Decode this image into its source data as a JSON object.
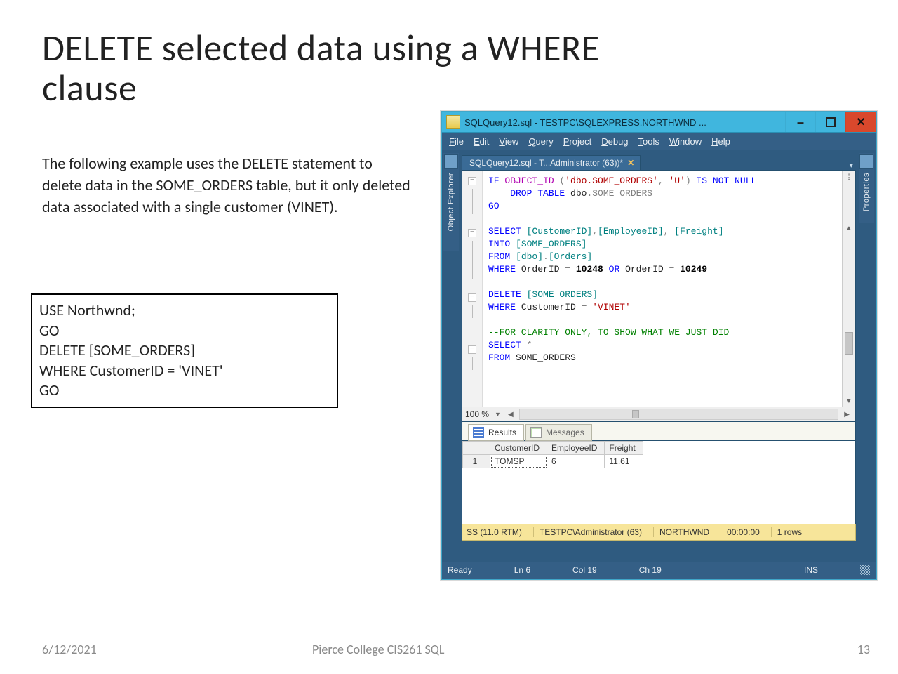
{
  "title": "DELETE selected data using a WHERE clause",
  "body": "The following example uses the DELETE statement to delete data in the SOME_ORDERS table, but it only deleted data associated with a single customer (VINET).",
  "codebox": "USE Northwnd;\nGO\nDELETE [SOME_ORDERS]\nWHERE CustomerID = 'VINET'\nGO",
  "footer": {
    "date": "6/12/2021",
    "center": "Pierce College CIS261 SQL",
    "page": "13"
  },
  "ssms": {
    "window_title": "SQLQuery12.sql - TESTPC\\SQLEXPRESS.NORTHWND ...",
    "menu": [
      "File",
      "Edit",
      "View",
      "Query",
      "Project",
      "Debug",
      "Tools",
      "Window",
      "Help"
    ],
    "tab": "SQLQuery12.sql - T...Administrator (63))*",
    "left_dock": "Object Explorer",
    "right_dock": "Properties",
    "zoom": "100 %",
    "result_tabs": {
      "results": "Results",
      "messages": "Messages"
    },
    "grid": {
      "headers": [
        "CustomerID",
        "EmployeeID",
        "Freight"
      ],
      "rownum": "1",
      "row": [
        "TOMSP",
        "6",
        "11.61"
      ]
    },
    "yellow": {
      "ver": "SS (11.0 RTM)",
      "user": "TESTPC\\Administrator (63)",
      "db": "NORTHWND",
      "time": "00:00:00",
      "rows": "1 rows"
    },
    "status": {
      "ready": "Ready",
      "ln": "Ln 6",
      "col": "Col 19",
      "ch": "Ch 19",
      "ins": "INS"
    },
    "sql": {
      "l1a": "IF",
      "l1b": " OBJECT_ID ",
      "l1c": "(",
      "l1d": "'dbo.SOME_ORDERS'",
      "l1e": ", ",
      "l1f": "'U'",
      "l1g": ")",
      "l1h": " IS NOT NULL",
      "l2a": "    DROP TABLE",
      "l2b": " dbo",
      "l2c": ".SOME_ORDERS",
      "l3": "GO",
      "l5a": "SELECT",
      "l5b": " [CustomerID]",
      "l5c": ",",
      "l5d": "[EmployeeID]",
      "l5e": ", ",
      "l5f": "[Freight]",
      "l6a": "INTO",
      "l6b": " [SOME_ORDERS]",
      "l7a": "FROM",
      "l7b": " [dbo]",
      "l7c": ".",
      "l7d": "[Orders]",
      "l8a": "WHERE",
      "l8b": " OrderID ",
      "l8c": "=",
      "l8d": " 10248 ",
      "l8e": "OR",
      "l8f": " OrderID ",
      "l8g": "=",
      "l8h": " 10249",
      "l10a": "DELETE",
      "l10b": " [SOME_ORDERS]",
      "l11a": "WHERE",
      "l11b": " CustomerID ",
      "l11c": "=",
      "l11d": " 'VINET'",
      "l13": "--FOR CLARITY ONLY, TO SHOW WHAT WE JUST DID",
      "l14a": "SELECT",
      "l14b": " *",
      "l15a": "FROM",
      "l15b": " SOME_ORDERS"
    }
  }
}
